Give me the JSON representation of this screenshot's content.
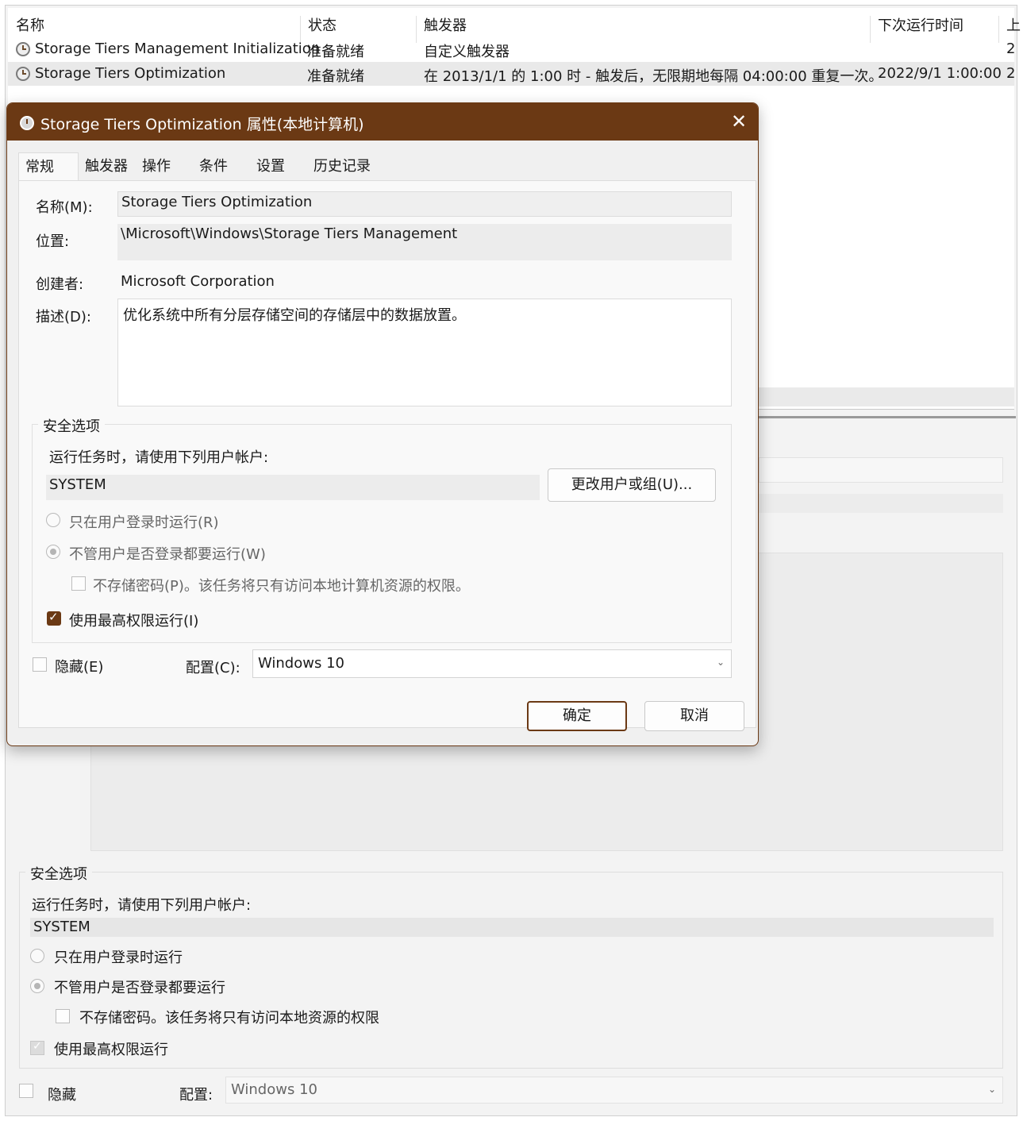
{
  "task_list": {
    "columns": [
      "名称",
      "状态",
      "触发器",
      "下次运行时间",
      "上"
    ],
    "rows": [
      {
        "name": "Storage Tiers Management Initialization",
        "status": "准备就绪",
        "trigger": "自定义触发器",
        "next_run": "",
        "extra": "2"
      },
      {
        "name": "Storage Tiers Optimization",
        "status": "准备就绪",
        "trigger": "在 2013/1/1 的 1:00 时 - 触发后，无限期地每隔 04:00:00 重复一次。",
        "next_run": "2022/9/1 1:00:00",
        "extra": "2"
      }
    ]
  },
  "background_panel": {
    "security_title": "安全选项",
    "run_as_label": "运行任务时，请使用下列用户帐户:",
    "account": "SYSTEM",
    "radio_logged_on": "只在用户登录时运行",
    "radio_whether": "不管用户是否登录都要运行",
    "no_store_password": "不存储密码。该任务将只有访问本地资源的权限",
    "highest_privileges": "使用最高权限运行",
    "hidden_label": "隐藏",
    "config_label": "配置:",
    "config_value": "Windows 10"
  },
  "dialog": {
    "title": "Storage Tiers Optimization 属性(本地计算机)",
    "close_glyph": "✕",
    "tabs": [
      "常规",
      "触发器",
      "操作",
      "条件",
      "设置",
      "历史记录"
    ],
    "name_label": "名称(M):",
    "name_value": "Storage Tiers Optimization",
    "location_label": "位置:",
    "location_value": "\\Microsoft\\Windows\\Storage Tiers Management",
    "author_label": "创建者:",
    "author_value": "Microsoft Corporation",
    "description_label": "描述(D):",
    "description_value": "优化系统中所有分层存储空间的存储层中的数据放置。",
    "security_title": "安全选项",
    "run_as_label": "运行任务时，请使用下列用户帐户:",
    "account": "SYSTEM",
    "change_user_button": "更改用户或组(U)...",
    "radio_logged_on": "只在用户登录时运行(R)",
    "radio_whether": "不管用户是否登录都要运行(W)",
    "no_store_password": "不存储密码(P)。该任务将只有访问本地计算机资源的权限。",
    "highest_privileges": "使用最高权限运行(I)",
    "hidden_label": "隐藏(E)",
    "config_label": "配置(C):",
    "config_value": "Windows 10",
    "ok_button": "确定",
    "cancel_button": "取消"
  },
  "colors": {
    "accent": "#6b3914",
    "selected_row": "#e9e9e9"
  }
}
